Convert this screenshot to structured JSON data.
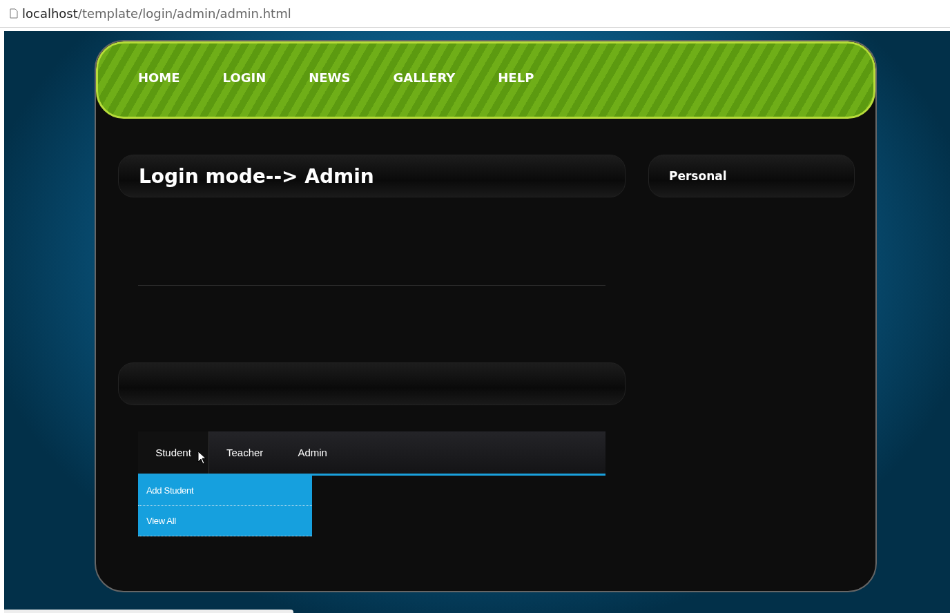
{
  "address_bar": {
    "host": "localhost",
    "path": "/template/login/admin/admin.html"
  },
  "nav": [
    {
      "label": "HOME"
    },
    {
      "label": "LOGIN"
    },
    {
      "label": "NEWS"
    },
    {
      "label": "GALLERY"
    },
    {
      "label": "HELP"
    }
  ],
  "main_panel": {
    "title": "Login mode--> Admin"
  },
  "side_panel": {
    "title": "Personal"
  },
  "tabs": [
    {
      "label": "Student",
      "selected": true
    },
    {
      "label": "Teacher",
      "selected": false
    },
    {
      "label": "Admin",
      "selected": false
    }
  ],
  "dropdown": [
    {
      "label": "Add Student"
    },
    {
      "label": "View All"
    }
  ]
}
